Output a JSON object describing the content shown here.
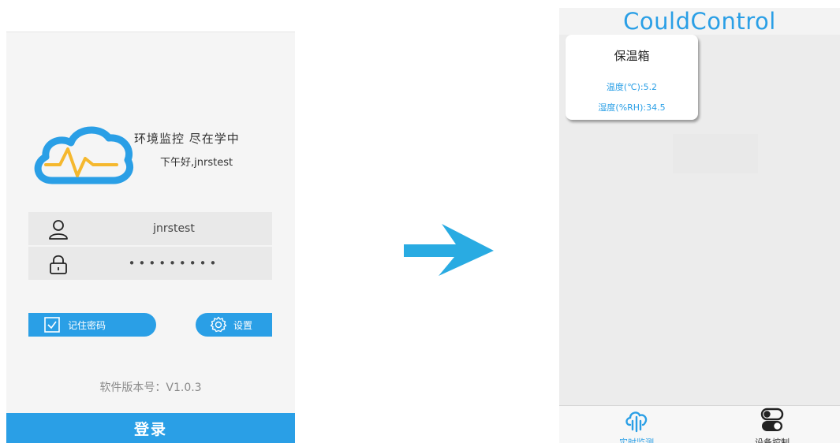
{
  "login_screen": {
    "slogan": "环境监控 尽在学中",
    "greeting": "下午好,jnrstest",
    "username": {
      "value": "jnrstest",
      "icon": "user-icon"
    },
    "password": {
      "value": "•••••••••",
      "icon": "lock-icon"
    },
    "remember_label": "记住密码",
    "settings_label": "设置",
    "version": "软件版本号：V1.0.3",
    "login_label": "登录",
    "colors": {
      "accent": "#2a9fe6",
      "logo_pulse": "#f5b82e"
    }
  },
  "transition": {
    "icon": "arrow-right-icon",
    "color": "#29abe2"
  },
  "monitor_screen": {
    "title": "CouldControl",
    "device": {
      "name": "保温箱",
      "temperature": "温度(℃):5.2",
      "humidity": "湿度(%RH):34.5"
    },
    "nav": [
      {
        "label": "实时监测",
        "icon": "cloud-monitor-icon",
        "active": true
      },
      {
        "label": "设备控制",
        "icon": "toggle-switches-icon",
        "active": false
      }
    ]
  }
}
